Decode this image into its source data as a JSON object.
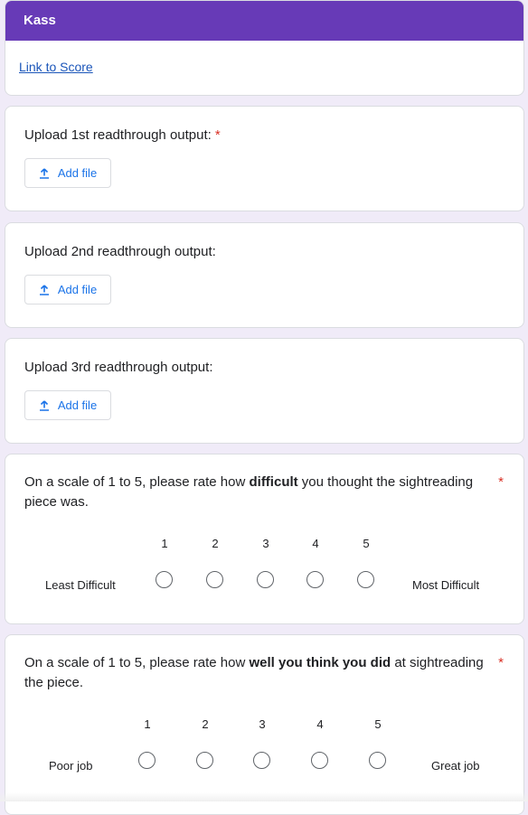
{
  "header": {
    "title": "Kass",
    "link_text": "Link to Score"
  },
  "uploads": [
    {
      "question": "Upload 1st readthrough output:",
      "required": "*",
      "button": "Add file"
    },
    {
      "question": "Upload 2nd readthrough output:",
      "required": "",
      "button": "Add file"
    },
    {
      "question": "Upload 3rd readthrough output:",
      "required": "",
      "button": "Add file"
    }
  ],
  "rating_difficulty": {
    "pre": "On a scale of 1 to 5, please rate how ",
    "bold": "difficult",
    "post": " you thought the sightreading piece was.",
    "required": "*",
    "scale": [
      "1",
      "2",
      "3",
      "4",
      "5"
    ],
    "low_label": "Least Difficult",
    "high_label": "Most Difficult"
  },
  "rating_performance": {
    "pre": "On a scale of 1 to 5, please rate how ",
    "bold": "well you think you did",
    "post": " at sightreading the piece.",
    "required": "*",
    "scale": [
      "1",
      "2",
      "3",
      "4",
      "5"
    ],
    "low_label": "Poor job",
    "high_label": "Great job"
  },
  "colors": {
    "accent": "#673ab7",
    "link": "#1a55b9",
    "button_text": "#1a73e8",
    "required": "#d93025"
  }
}
